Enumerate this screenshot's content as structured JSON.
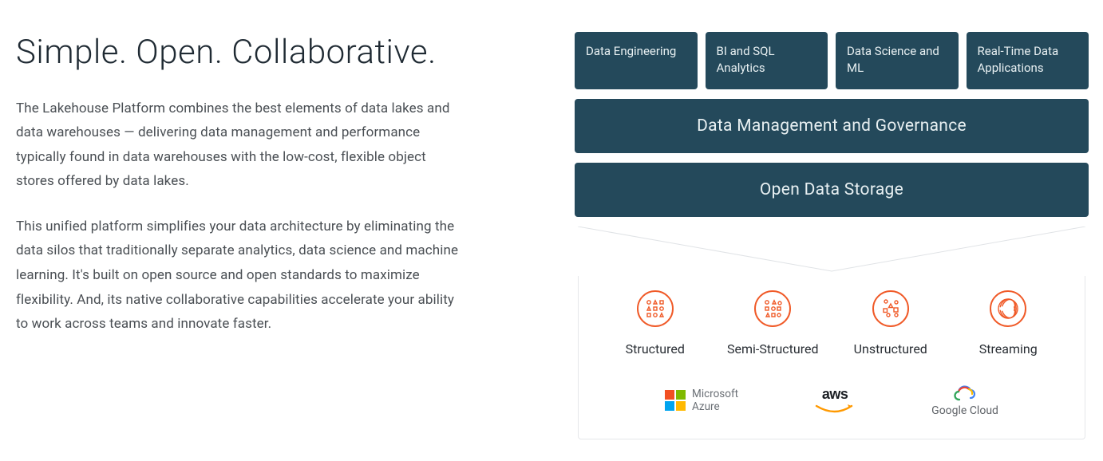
{
  "headline": "Simple. Open. Collaborative.",
  "para1": "The Lakehouse Platform combines the best elements of data lakes and data warehouses — delivering data management and performance typically found in data warehouses with the low-cost, flexible object stores offered by data lakes.",
  "para2": "This unified platform simplifies your data architecture by eliminating the data silos that traditionally separate analytics, data science and machine learning. It's built on open source and open standards to maximize flexibility. And, its native collaborative capabilities accelerate your ability to work across teams and innovate faster.",
  "tiles": {
    "t1": "Data Engineering",
    "t2": "BI and SQL Analytics",
    "t3": "Data Science and ML",
    "t4": "Real-Time Data Applications"
  },
  "wide1": "Data Management and Governance",
  "wide2": "Open Data Storage",
  "formats": {
    "f1": "Structured",
    "f2": "Semi-Structured",
    "f3": "Unstructured",
    "f4": "Streaming"
  },
  "clouds": {
    "azure_line1": "Microsoft",
    "azure_line2": "Azure",
    "aws": "aws",
    "gcloud": "Google Cloud"
  },
  "colors": {
    "tile_bg": "#24495b",
    "accent": "#f05a28"
  }
}
